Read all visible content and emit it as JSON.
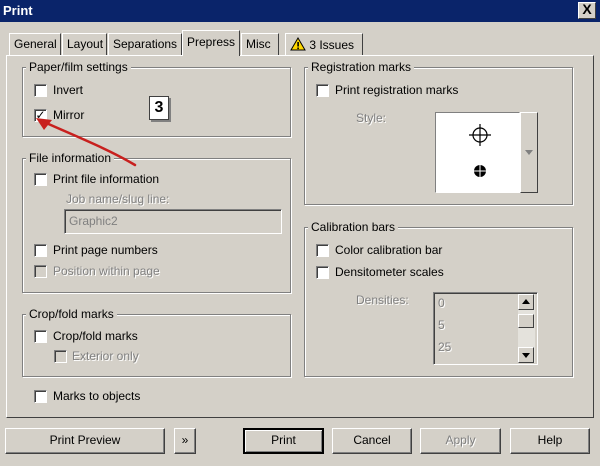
{
  "window": {
    "title": "Print",
    "close_symbol": "X"
  },
  "tabs": [
    {
      "label": "General"
    },
    {
      "label": "Layout"
    },
    {
      "label": "Separations"
    },
    {
      "label": "Prepress",
      "active": true
    },
    {
      "label": "Misc"
    },
    {
      "label": "3 Issues",
      "icon": "warning-icon"
    }
  ],
  "paper_film": {
    "legend": "Paper/film settings",
    "invert_label": "Invert",
    "invert_checked": false,
    "mirror_label": "Mirror",
    "mirror_checked": true,
    "page_icon_glyph": "3"
  },
  "file_info": {
    "legend": "File information",
    "print_file_info_label": "Print file information",
    "job_name_label": "Job name/slug line:",
    "job_name_value": "Graphic2",
    "print_page_numbers_label": "Print page numbers",
    "position_within_page_label": "Position within page"
  },
  "crop_fold": {
    "legend": "Crop/fold marks",
    "crop_fold_label": "Crop/fold marks",
    "exterior_only_label": "Exterior only"
  },
  "marks_to_objects_label": "Marks to objects",
  "registration": {
    "legend": "Registration marks",
    "print_registration_label": "Print registration marks",
    "style_label": "Style:"
  },
  "calibration": {
    "legend": "Calibration bars",
    "color_bar_label": "Color calibration bar",
    "densitometer_label": "Densitometer scales",
    "densities_label": "Densities:",
    "densities_values": [
      "0",
      "5",
      "25"
    ]
  },
  "buttons": {
    "print_preview": "Print Preview",
    "expand_symbol": "»",
    "print": "Print",
    "cancel": "Cancel",
    "apply": "Apply",
    "help": "Help"
  },
  "annotation": {
    "arrow_color": "#c8201e"
  },
  "colors": {
    "titlebar": "#0a246a",
    "face": "#d4d0c8"
  }
}
